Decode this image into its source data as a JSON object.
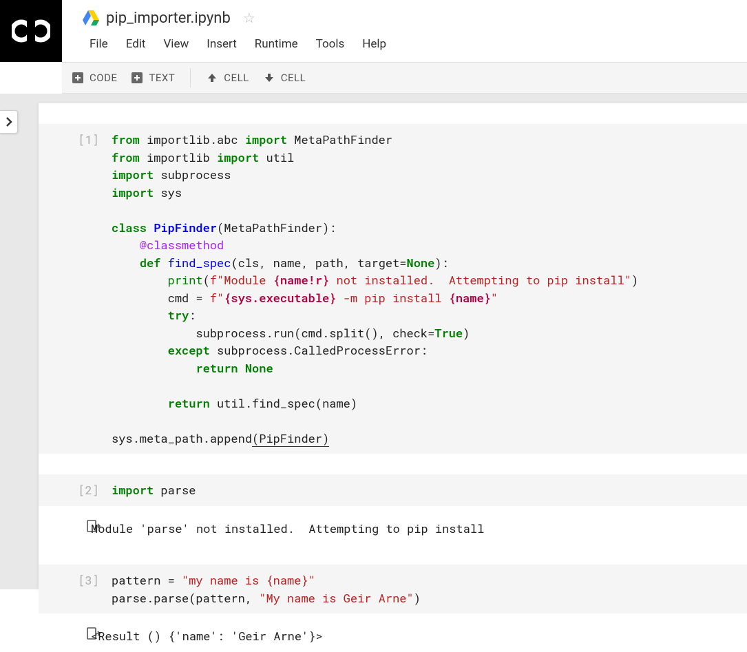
{
  "header": {
    "title": "pip_importer.ipynb"
  },
  "menu": {
    "file": "File",
    "edit": "Edit",
    "view": "View",
    "insert": "Insert",
    "runtime": "Runtime",
    "tools": "Tools",
    "help": "Help"
  },
  "toolbar": {
    "code": "CODE",
    "text": "TEXT",
    "cell_up": "CELL",
    "cell_down": "CELL"
  },
  "cells": [
    {
      "prompt": "[1]",
      "code_html": "<span class=\"kw\">from</span> importlib.abc <span class=\"kw\">import</span> MetaPathFinder\n<span class=\"kw\">from</span> importlib <span class=\"kw\">import</span> util\n<span class=\"kw\">import</span> subprocess\n<span class=\"kw\">import</span> sys\n\n<span class=\"kw\">class</span> <span class=\"cn\">PipFinder</span>(MetaPathFinder):\n    <span class=\"dec\">@classmethod</span>\n    <span class=\"kw\">def</span> <span class=\"fn\">find_spec</span>(cls, name, path, target=<span class=\"kc\">None</span>):\n        <span class=\"nb\">print</span>(<span class=\"sa\">f</span><span class=\"s2\">&quot;Module </span><span class=\"si\">{name!r}</span><span class=\"s2\"> not installed.  Attempting to pip install&quot;</span>)\n        cmd = <span class=\"sa\">f</span><span class=\"s2\">&quot;</span><span class=\"si\">{sys.executable}</span><span class=\"s2\"> -m pip install </span><span class=\"si\">{name}</span><span class=\"s2\">&quot;</span>\n        <span class=\"kw\">try</span>:\n            subprocess.run(cmd.split(), check=<span class=\"kc\">True</span>)\n        <span class=\"kw\">except</span> subprocess.CalledProcessError:\n            <span class=\"kw\">return</span> <span class=\"kc\">None</span>\n\n        <span class=\"kw\">return</span> util.find_spec(name)\n\nsys.meta_path.append<span class=\"border-u\">(PipFinder)</span>"
    },
    {
      "prompt": "[2]",
      "code_html": "<span class=\"kw\">import</span> parse",
      "output": "Module 'parse' not installed.  Attempting to pip install"
    },
    {
      "prompt": "[3]",
      "code_html": "pattern = <span class=\"s2\">&quot;my name is {name}&quot;</span>\nparse.parse(pattern, <span class=\"s2\">&quot;My name is Geir Arne&quot;</span>)",
      "output": "<Result () {'name': 'Geir Arne'}>"
    }
  ]
}
